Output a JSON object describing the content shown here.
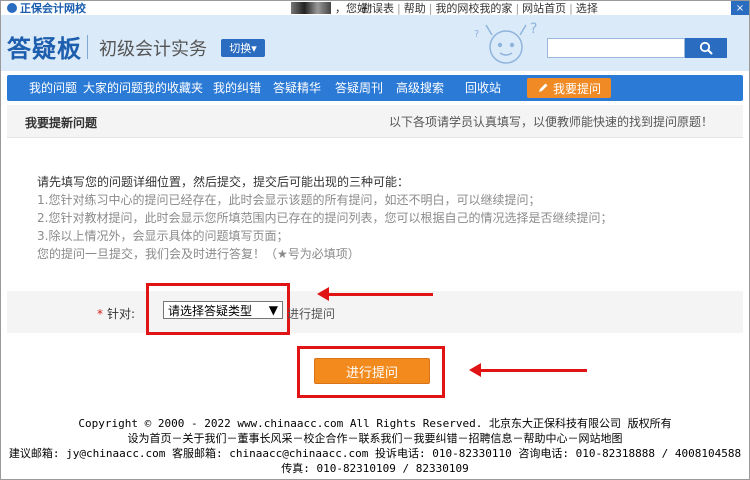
{
  "topbar": {
    "site_name": "正保会计网校",
    "greeting": "，您好！",
    "links": [
      "勘误表",
      "帮助",
      "我的网校我的家",
      "网站首页",
      "选择"
    ],
    "close_label": "×"
  },
  "header": {
    "brand": "答疑板",
    "subject": "初级会计实务",
    "switch_label": "切换▾",
    "search_placeholder": ""
  },
  "nav": {
    "items": [
      "我的问题",
      "大家的问题",
      "我的收藏夹",
      "我的纠错",
      "答疑精华",
      "答疑周刊",
      "高级搜索",
      "回收站"
    ],
    "ask_label": "我要提问"
  },
  "section": {
    "title": "我要提新问题",
    "hint": "以下各项请学员认真填写，以便教师能快速的找到提问原题！"
  },
  "instructions": {
    "lead": "请先填写您的问题详细位置，然后提交，提交后可能出现的三种可能：",
    "lines": [
      "1.您针对练习中心的提问已经存在，此时会显示该题的所有提问，如还不明白，可以继续提问；",
      "2.您针对教材提问，此时会显示您所填范围内已存在的提问列表，您可以根据自己的情况选择是否继续提问；",
      "3.除以上情况外，会显示具体的问题填写页面；"
    ],
    "closing": "您的提问一旦提交，我们会及时进行答复！（★号为必填项）"
  },
  "form": {
    "required_mark": "*",
    "label": "针对:",
    "select_value": "请选择答疑类型",
    "after_text": "进行提问"
  },
  "submit_label": "进行提问",
  "footer": {
    "copyright": "Copyright © 2000 - 2022 www.chinaacc.com All Rights Reserved.  北京东大正保科技有限公司 版权所有",
    "links": "设为首页－关于我们－董事长风采－校企合作－联系我们－我要纠错－招聘信息－帮助中心－网站地图",
    "contact": "建议邮箱: jy@chinaacc.com 客服邮箱: chinaacc@chinaacc.com 投诉电话: 010-82330110 咨询电话: 010-82318888 / 4008104588",
    "fax": "传真: 010-82310109 / 82330109"
  },
  "colors": {
    "brand_blue": "#2a7ad6",
    "header_bg": "#dbeaf8",
    "accent_orange": "#f28a1e",
    "highlight_red": "#e01414"
  }
}
